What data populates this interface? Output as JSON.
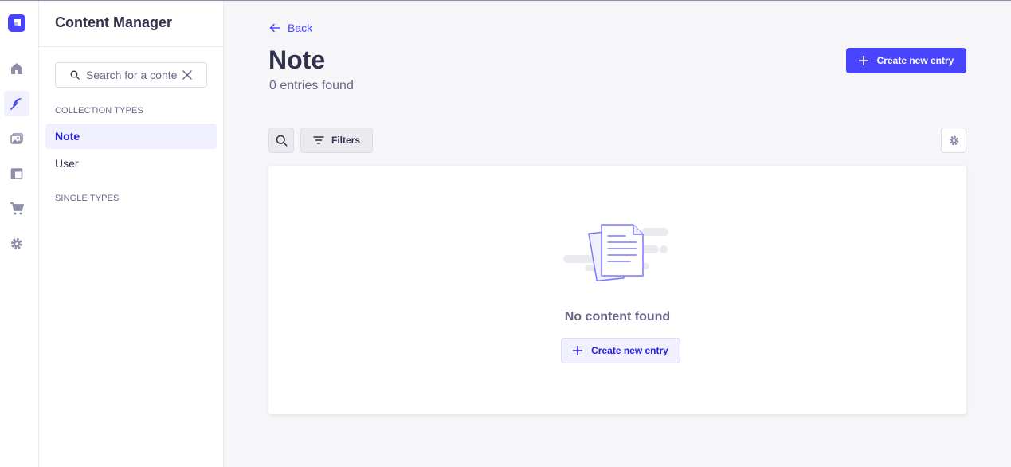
{
  "colors": {
    "primary": "#4945ff",
    "primary_light": "#f0f0ff",
    "text": "#32324d",
    "muted": "#666687",
    "background": "#f6f6f9"
  },
  "rail": {
    "items": [
      {
        "icon": "home-icon"
      },
      {
        "icon": "content-manager-feather-icon",
        "active": true
      },
      {
        "icon": "media-library-icon"
      },
      {
        "icon": "content-type-builder-icon"
      },
      {
        "icon": "marketplace-cart-icon"
      },
      {
        "icon": "settings-gear-icon"
      }
    ]
  },
  "sidebar": {
    "title": "Content Manager",
    "search_placeholder": "Search for a content type",
    "collection_types_label": "COLLECTION TYPES",
    "collection_types": [
      {
        "label": "Note",
        "active": true
      },
      {
        "label": "User",
        "active": false
      }
    ],
    "single_types_label": "SINGLE TYPES"
  },
  "header": {
    "back_label": "Back",
    "title": "Note",
    "subtitle": "0 entries found",
    "create_button_label": "Create new entry"
  },
  "toolbar": {
    "filters_label": "Filters"
  },
  "empty_state": {
    "message": "No content found",
    "create_button_label": "Create new entry"
  }
}
